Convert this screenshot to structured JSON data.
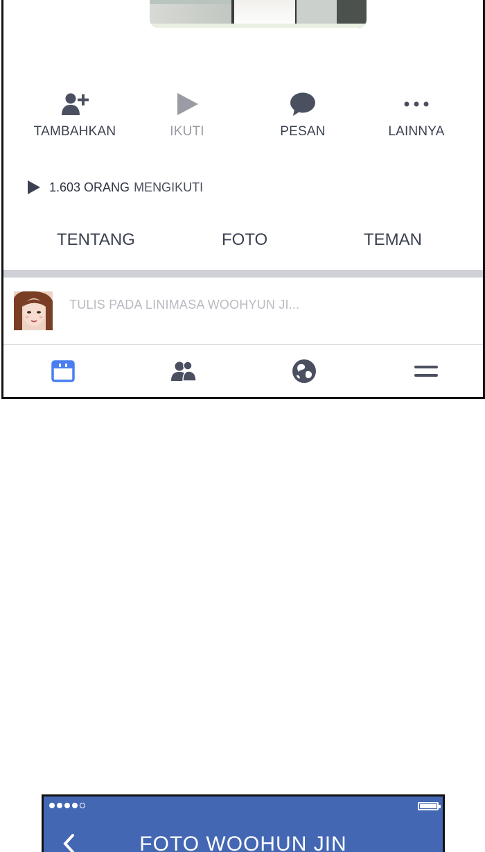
{
  "profile": {
    "actions": [
      {
        "label": "TAMBAHKAN",
        "icon": "add-friend-icon",
        "enabled": true
      },
      {
        "label": "IKUTI",
        "icon": "follow-play-icon",
        "enabled": false
      },
      {
        "label": "PESAN",
        "icon": "message-bubble-icon",
        "enabled": true
      },
      {
        "label": "LAINNYA",
        "icon": "more-dots-icon",
        "enabled": true
      }
    ],
    "followers": {
      "count_text": "1.603 ORANG",
      "suffix_text": "MENGIKUTI",
      "icon": "follow-play-icon"
    },
    "tabs": [
      {
        "label": "TENTANG"
      },
      {
        "label": "FOTO"
      },
      {
        "label": "TEMAN"
      }
    ],
    "composer": {
      "placeholder": "TULIS PADA LINIMASA WOOHYUN JI..."
    },
    "bottom_nav": [
      {
        "icon": "news-feed-icon",
        "active": true
      },
      {
        "icon": "friends-icon",
        "active": false
      },
      {
        "icon": "globe-icon",
        "active": false
      },
      {
        "icon": "menu-icon",
        "active": false
      }
    ]
  },
  "second_screen": {
    "title": "FOTO WOOHUN JIN",
    "back_icon": "back-chevron-icon",
    "battery_icon": "battery-icon",
    "signal_icon": "signal-dots-icon"
  },
  "colors": {
    "text_dark": "#3b4150",
    "text_disabled": "#9a9ca3",
    "placeholder": "#b9bbc1",
    "active_blue": "#4a7ef0",
    "icon_gray": "#4b5060",
    "header_blue": "#4467b4",
    "divider": "#d0d1d6"
  }
}
